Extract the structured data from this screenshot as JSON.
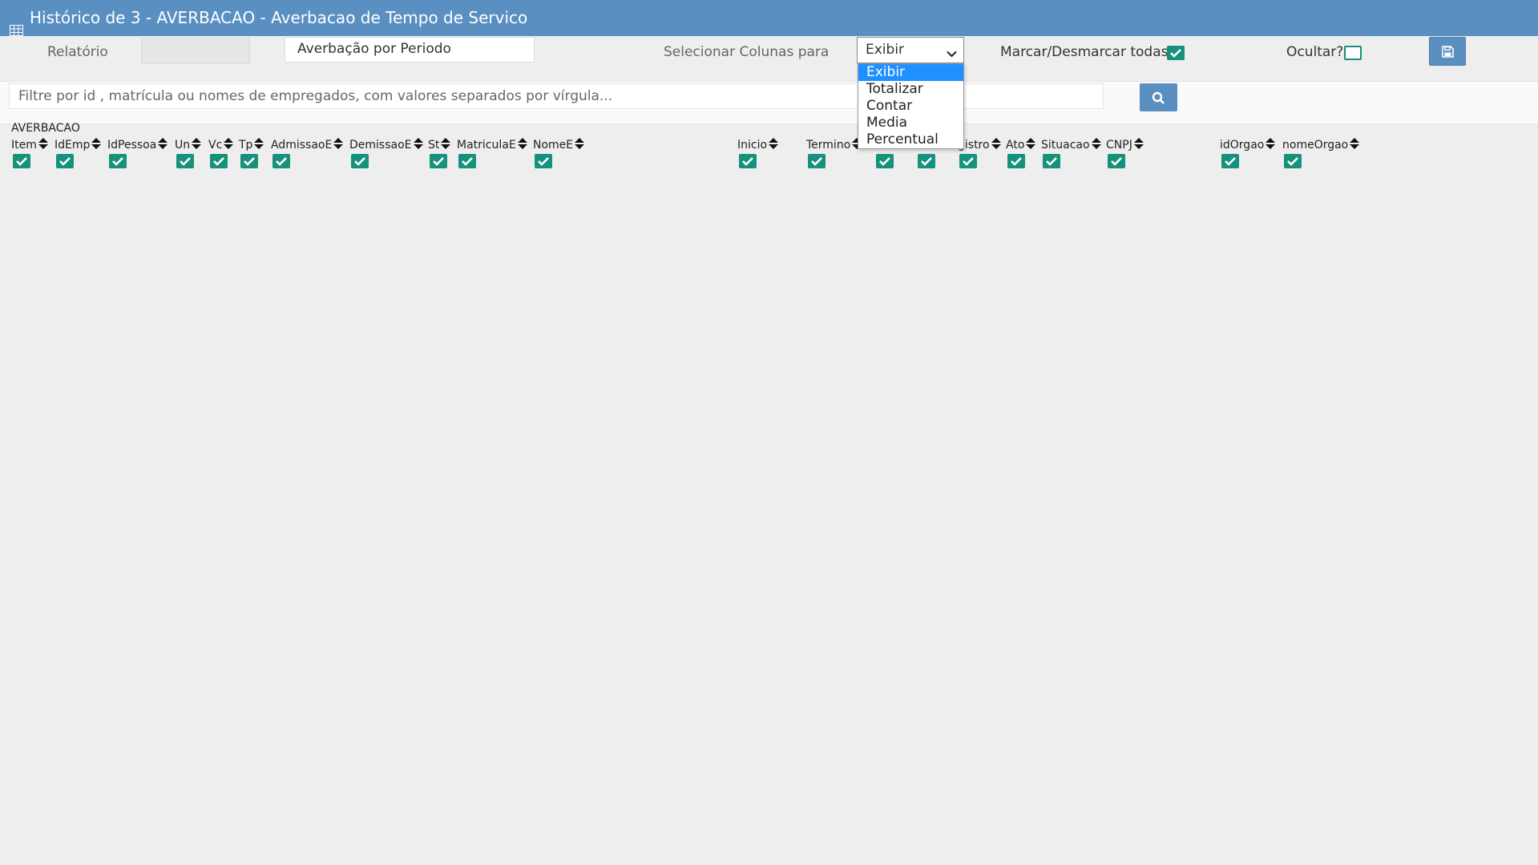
{
  "title": "Histórico de 3 - AVERBACAO - Averbacao de Tempo de Servico",
  "title_icon": "table-icon",
  "toolbar": {
    "relatorio_label": "Relatório",
    "report_name": "Averbação por Periodo",
    "select_columns_label": "Selecionar Colunas para",
    "select_value": "Exibir",
    "select_options": [
      "Exibir",
      "Totalizar",
      "Contar",
      "Media",
      "Percentual"
    ],
    "marcar_label": "Marcar/Desmarcar todas",
    "marcar_checked": true,
    "ocultar_label": "Ocultar?",
    "ocultar_checked": false,
    "save_icon": "floppy-disk-icon"
  },
  "filter": {
    "placeholder": "Filtre por id , matrícula ou nomes de empregados, com valores separados por vírgula...",
    "search_icon": "search-icon"
  },
  "group": "AVERBACAO",
  "columns": [
    "Item",
    "IdEmp",
    "IdPessoa",
    "Un",
    "Vc",
    "Tp",
    "AdmissaoE",
    "DemissaoE",
    "St",
    "MatriculaE",
    "NomeE",
    "Inicio",
    "Termino",
    "",
    "",
    "gistro",
    "Ato",
    "Situacao",
    "CNPJ",
    "idOrgao",
    "nomeOrgao"
  ],
  "colors": {
    "header": "#5a8fc1",
    "checkbox": "#16917b",
    "highlight": "#1e90ff",
    "background": "#eeeeee"
  }
}
